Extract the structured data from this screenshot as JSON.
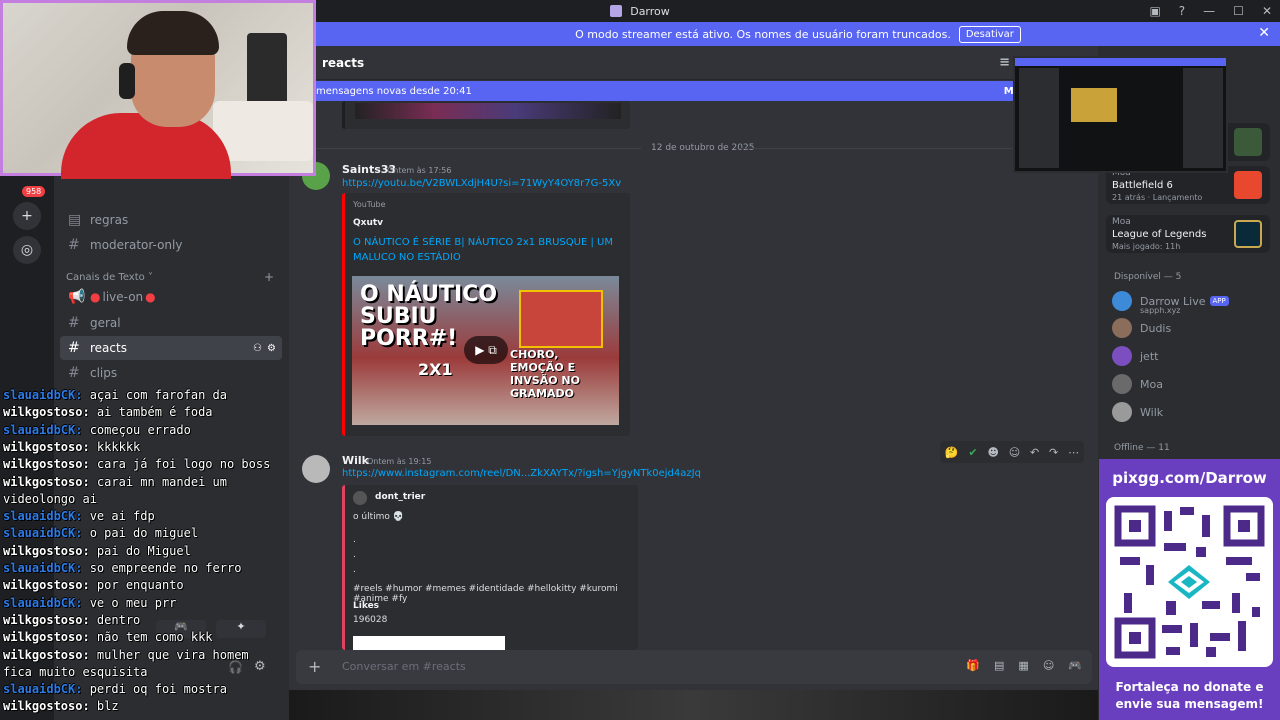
{
  "window": {
    "title": "Darrow"
  },
  "banner": {
    "text": "O modo streamer está ativo. Os nomes de usuário foram truncados.",
    "button": "Desativar"
  },
  "guilds": {
    "badge": "958"
  },
  "channels": {
    "items": [
      {
        "label": "regras"
      },
      {
        "label": "moderator-only"
      }
    ],
    "category_text": "Canais de Texto",
    "text_items": [
      {
        "label": "live-on"
      },
      {
        "label": "geral"
      },
      {
        "label": "reacts"
      },
      {
        "label": "clips"
      }
    ]
  },
  "header": {
    "channel": "reacts"
  },
  "new_messages": {
    "text": "mensagens novas desde 20:41",
    "mark": "Marca"
  },
  "messages": {
    "date_divider": "12 de outubro de 2025",
    "m1": {
      "author": "Saints33",
      "timestamp": "Ontem às 17:56",
      "link": "https://youtu.be/V2BWLXdjH4U?si=71WyY4OY8r7G-5Xv",
      "embed_provider": "YouTube",
      "embed_author": "Qxutv",
      "embed_title": "O NÁUTICO É SÉRIE B| NÁUTICO 2x1 BRUSQUE | UM MALUCO NO ESTÁDIO",
      "thumb_text_1": "O NÁUTICO SUBIU PORR#!",
      "thumb_text_2": "CHORO, EMOÇÃO E INVSÃO NO GRAMADO",
      "thumb_score": "2X1"
    },
    "m2": {
      "author": "Wilk",
      "timestamp": "Ontem às 19:15",
      "link": "https://www.instagram.com/reel/DN...ZkXAYTx/?igsh=YjgyNTk0ejd4azJq",
      "embed_author": "dont_trier",
      "embed_desc": "o último 💀",
      "dots": ".",
      "tags": "#reels #humor #memes #identidade #hellokitty #kuromi #anime #fy",
      "likes_label": "Likes",
      "likes_value": "196028"
    }
  },
  "composer": {
    "placeholder": "Conversar em #reacts"
  },
  "members": {
    "activity": [
      {
        "who": "Moa",
        "game": "Battlefield 6",
        "meta": "21 atrás · Lançamento"
      },
      {
        "who": "Moa",
        "game": "League of Legends",
        "meta": "Mais jogado: 11h"
      }
    ],
    "available_head": "Disponível — 5",
    "available": [
      {
        "name": "Darrow Live",
        "tag": "APP",
        "sub": "sapph.xyz"
      },
      {
        "name": "Dudis"
      },
      {
        "name": "jett"
      },
      {
        "name": "Moa"
      },
      {
        "name": "Wilk"
      }
    ],
    "offline_head": "Offline — 11"
  },
  "qr_panel": {
    "url": "pixgg.com/Darrow",
    "cta": "Fortaleça no donate e envie sua mensagem!"
  },
  "chat_overlay": [
    {
      "user": "slauaidbCK:",
      "msg": "açai com farofan da"
    },
    {
      "user": "wilkgostoso:",
      "msg": "ai também é foda"
    },
    {
      "user": "slauaidbCK:",
      "msg": "começou errado"
    },
    {
      "user": "wilkgostoso:",
      "msg": "kkkkkk"
    },
    {
      "user": "wilkgostoso:",
      "msg": "cara já foi logo no boss"
    },
    {
      "user": "wilkgostoso:",
      "msg": "carai mn mandei um"
    },
    {
      "user": "",
      "msg": "videolongo ai"
    },
    {
      "user": "slauaidbCK:",
      "msg": "ve ai fdp"
    },
    {
      "user": "slauaidbCK:",
      "msg": "o pai do miguel"
    },
    {
      "user": "wilkgostoso:",
      "msg": "pai do Miguel"
    },
    {
      "user": "slauaidbCK:",
      "msg": "so empreende no ferro"
    },
    {
      "user": "wilkgostoso:",
      "msg": "por enquanto"
    },
    {
      "user": "slauaidbCK:",
      "msg": "ve o meu prr"
    },
    {
      "user": "wilkgostoso:",
      "msg": "dentro"
    },
    {
      "user": "wilkgostoso:",
      "msg": "não tem como kkk"
    },
    {
      "user": "wilkgostoso:",
      "msg": "mulher que vira homem"
    },
    {
      "user": "",
      "msg": "fica muito esquisita"
    },
    {
      "user": "slauaidbCK:",
      "msg": "perdi oq foi mostra"
    },
    {
      "user": "wilkgostoso:",
      "msg": "blz"
    }
  ],
  "colors": {
    "accent": "#5865f2",
    "link": "#00a8fc",
    "qr_panel": "#6a3fbf",
    "chat_user": "#2e7be6"
  }
}
